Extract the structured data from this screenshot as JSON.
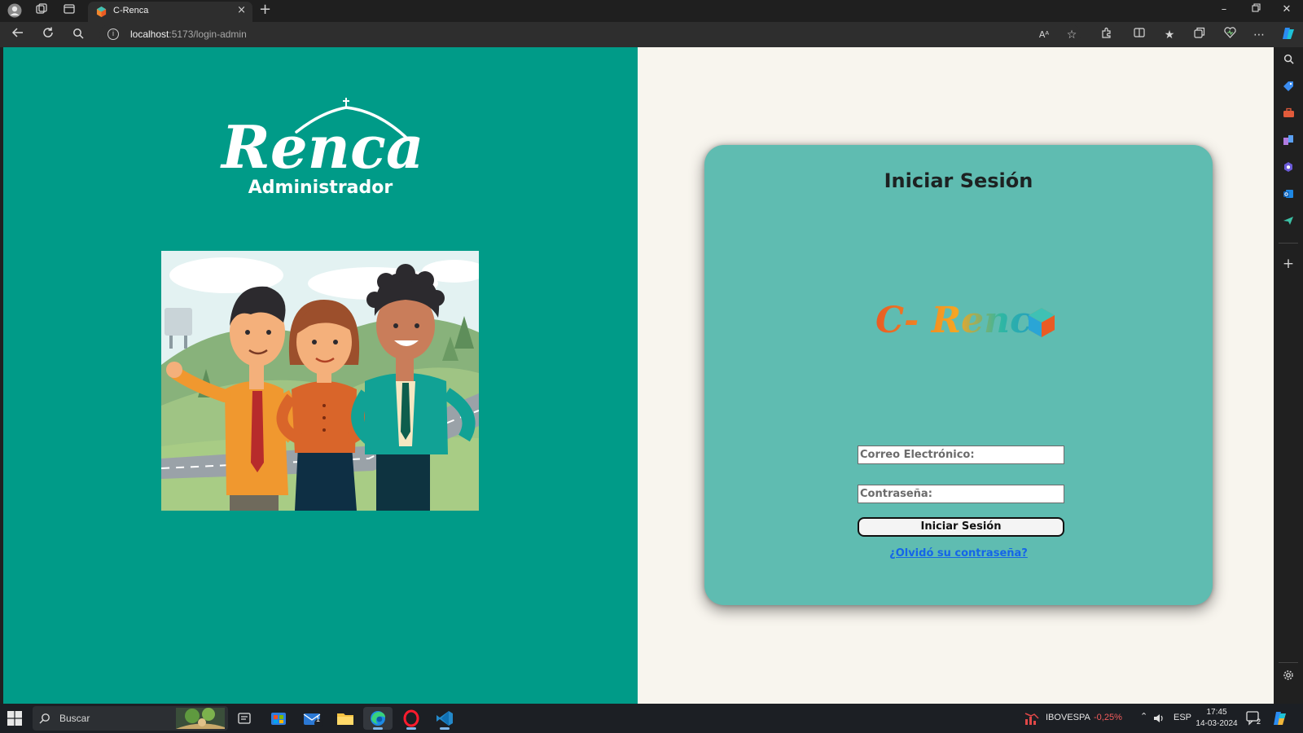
{
  "browser": {
    "tab_title": "C-Renca",
    "url_host": "localhost",
    "url_path": ":5173/login-admin",
    "new_tab_glyph": "+",
    "tab_close_glyph": "×",
    "read_aloud_glyph": "Aᴬ"
  },
  "left_panel": {
    "brand_name": "Renca",
    "subtitle": "Administrador",
    "background_color": "#009b88",
    "illustration": "three-cartoon-people-in-park"
  },
  "login": {
    "title": "Iniciar Sesión",
    "logo_text": "C- Renca",
    "email_placeholder": "Correo Electrónico:",
    "password_placeholder": "Contraseña:",
    "submit_label": "Iniciar Sesión",
    "forgot_link": "¿Olvidó su contraseña?",
    "card_color": "#5fbcb1"
  },
  "taskbar": {
    "search_placeholder": "Buscar",
    "mail_badge": "1",
    "ticker_name": "IBOVESPA",
    "ticker_change": "-0,25%",
    "ticker_color": "#f25c5c",
    "language": "ESP",
    "time": "17:45",
    "date": "14-03-2024",
    "notifications": "2"
  }
}
